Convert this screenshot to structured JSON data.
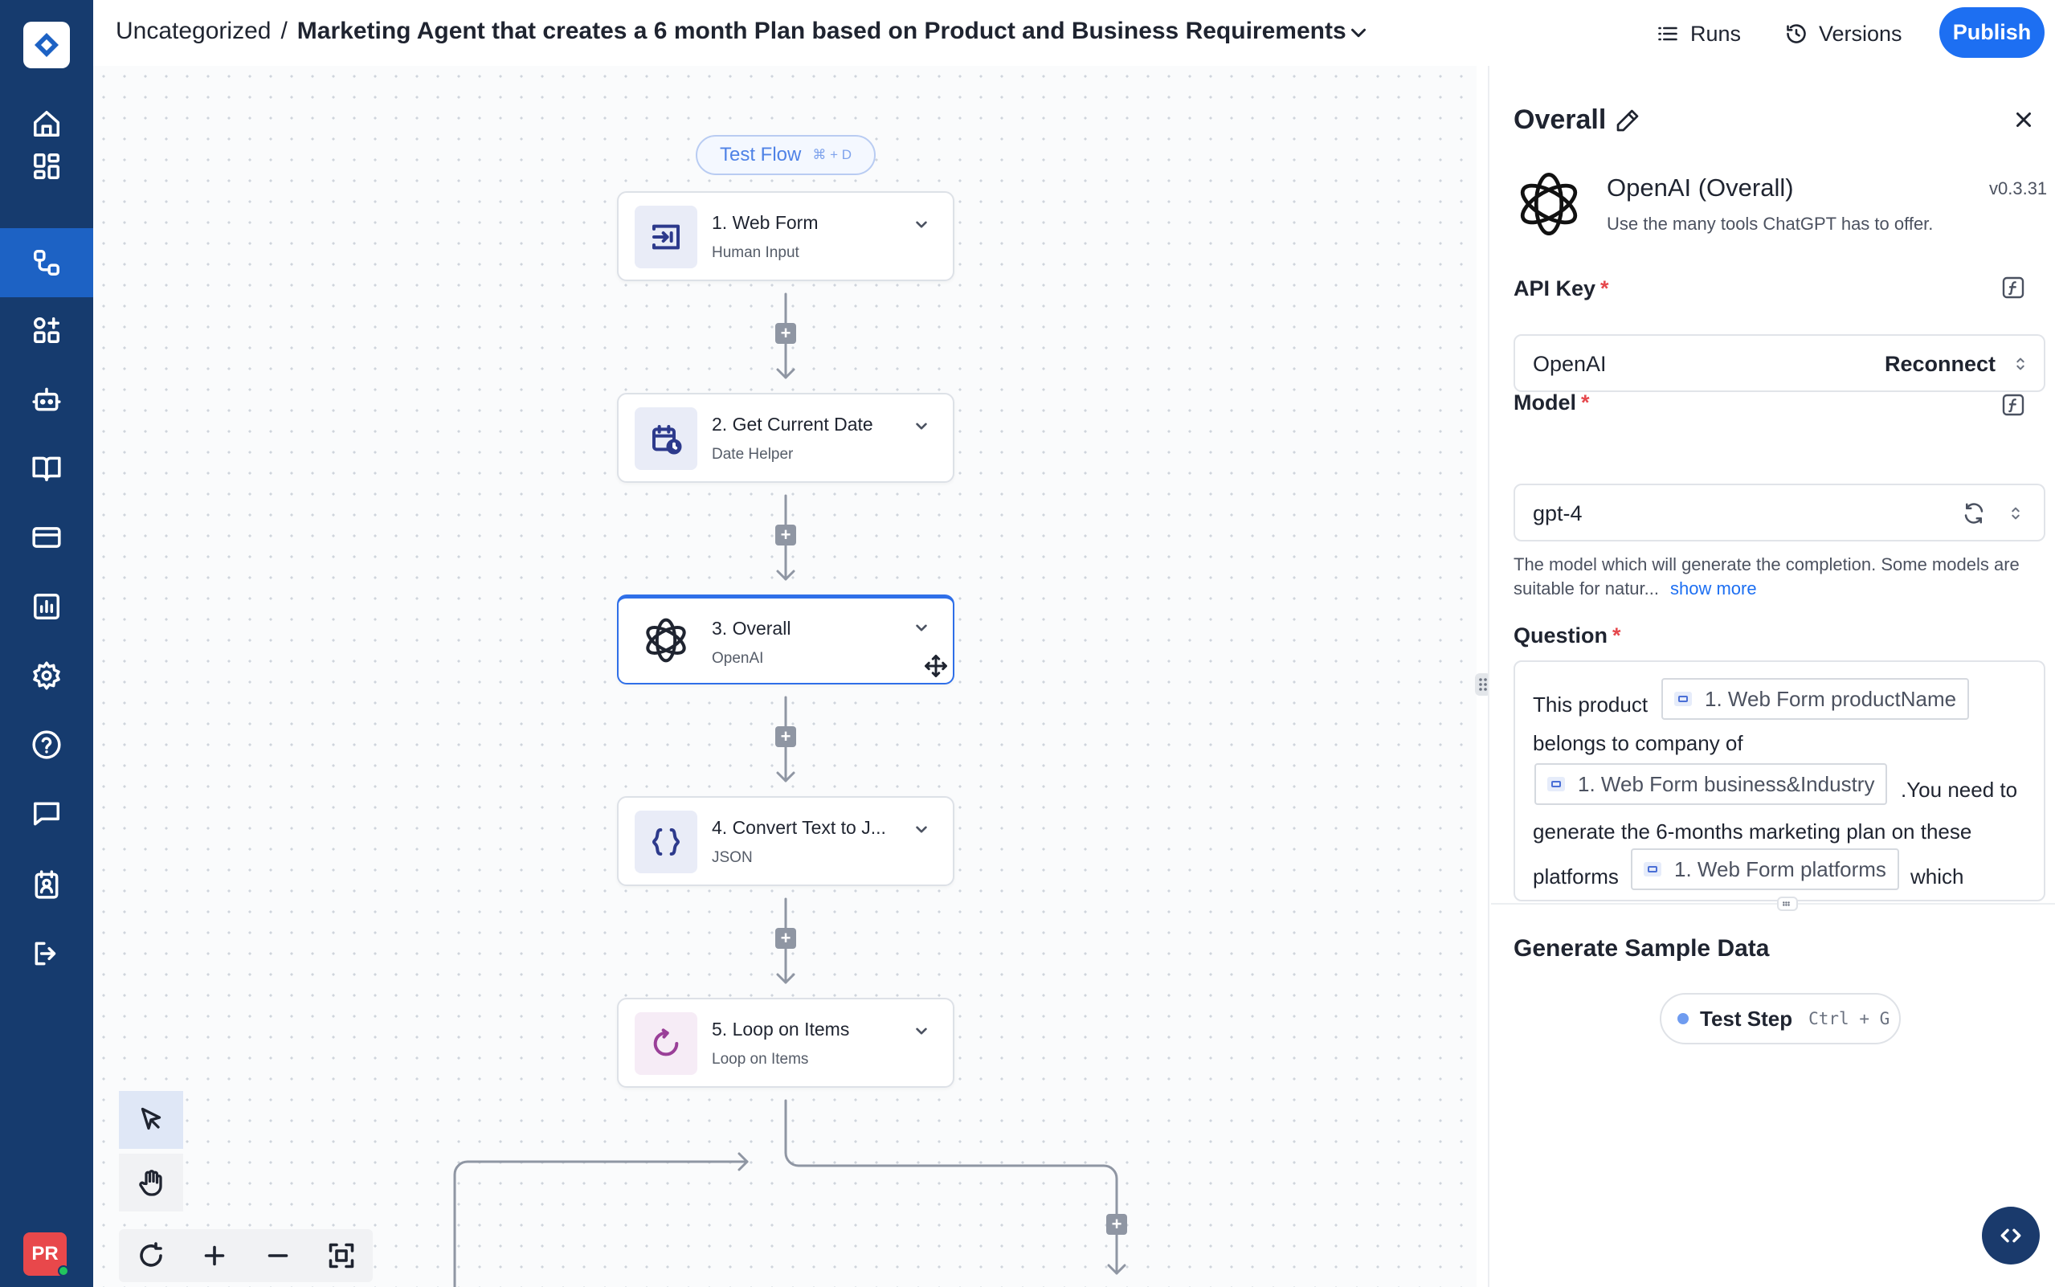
{
  "breadcrumb": {
    "category": "Uncategorized",
    "separator": "/",
    "flow_title": "Marketing Agent that creates a 6 month Plan based on Product and Business Requirements"
  },
  "header": {
    "runs_label": "Runs",
    "versions_label": "Versions",
    "publish_label": "Publish"
  },
  "sidebar": {
    "items": [
      "home-icon",
      "dashboard-icon",
      "flows-icon",
      "apps-icon",
      "bot-icon",
      "book-icon",
      "billing-icon",
      "analytics-icon",
      "settings-icon",
      "help-icon",
      "chat-icon",
      "contacts-icon",
      "logout-icon"
    ],
    "active_index": 2,
    "avatar_initials": "PR"
  },
  "canvas": {
    "test_flow_label": "Test Flow",
    "test_flow_shortcut": "⌘ + D",
    "nodes": [
      {
        "title": "1. Web Form",
        "subtitle": "Human Input",
        "icon": "web-form-icon"
      },
      {
        "title": "2. Get Current Date",
        "subtitle": "Date Helper",
        "icon": "calendar-clock-icon"
      },
      {
        "title": "3. Overall",
        "subtitle": "OpenAI",
        "icon": "openai-icon",
        "selected": true
      },
      {
        "title": "4. Convert Text to J...",
        "subtitle": "JSON",
        "icon": "braces-icon"
      },
      {
        "title": "5. Loop on Items",
        "subtitle": "Loop on Items",
        "icon": "loop-icon"
      }
    ]
  },
  "panel": {
    "title": "Overall",
    "app_name": "OpenAI (Overall)",
    "app_description": "Use the many tools ChatGPT has to offer.",
    "version": "v0.3.31",
    "api_key": {
      "label": "API Key",
      "required_mark": "*",
      "value": "OpenAI",
      "action": "Reconnect"
    },
    "model": {
      "label": "Model",
      "required_mark": "*",
      "value": "gpt-4",
      "help_text": "The model which will generate the completion. Some models are suitable for natur...",
      "show_more": "show more"
    },
    "question": {
      "label": "Question",
      "required_mark": "*",
      "text_1": "This product",
      "chip_1": "1. Web Form productName",
      "text_2": "belongs to company of",
      "chip_2": "1. Web Form business&Industry",
      "text_3": ".You need to",
      "text_4": "generate the 6-months marketing plan on these",
      "text_5": "platforms",
      "chip_3": "1. Web Form platforms",
      "text_6": "which"
    },
    "sample_data": {
      "title": "Generate Sample Data",
      "test_step_label": "Test Step",
      "test_step_shortcut": "Ctrl + G"
    }
  },
  "colors": {
    "sidebar_bg": "#163b6e",
    "sidebar_active": "#1d62c4",
    "accent": "#1d6ff2",
    "required": "#e5484d"
  }
}
